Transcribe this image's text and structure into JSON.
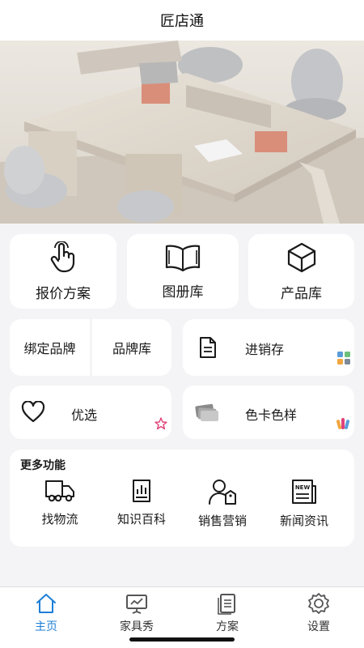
{
  "header": {
    "title": "匠店通"
  },
  "banner": {
    "slide_count": 3,
    "active_index": 1
  },
  "tiles": [
    {
      "label": "报价方案",
      "icon": "hand-tap-icon"
    },
    {
      "label": "图册库",
      "icon": "open-book-icon"
    },
    {
      "label": "产品库",
      "icon": "cube-icon"
    }
  ],
  "brand": {
    "bind_label": "绑定品牌",
    "library_label": "品牌库"
  },
  "inventory": {
    "label": "进销存",
    "icon": "document-icon"
  },
  "favorites": {
    "label": "优选",
    "icon": "heart-icon"
  },
  "color_card": {
    "label": "色卡色样",
    "icon": "color-swatch-icon"
  },
  "more": {
    "title": "更多功能",
    "items": [
      {
        "label": "找物流",
        "icon": "truck-icon"
      },
      {
        "label": "知识百科",
        "icon": "chart-book-icon"
      },
      {
        "label": "销售营销",
        "icon": "user-tag-icon"
      },
      {
        "label": "新闻资讯",
        "icon": "newspaper-icon",
        "badge": "NEW"
      }
    ]
  },
  "tabbar": {
    "active_color": "#1e7fd6",
    "tabs": [
      {
        "label": "主页",
        "icon": "home-icon",
        "active": true
      },
      {
        "label": "家具秀",
        "icon": "presentation-icon",
        "active": false
      },
      {
        "label": "方案",
        "icon": "documents-icon",
        "active": false
      },
      {
        "label": "设置",
        "icon": "settings-icon",
        "active": false
      }
    ]
  }
}
